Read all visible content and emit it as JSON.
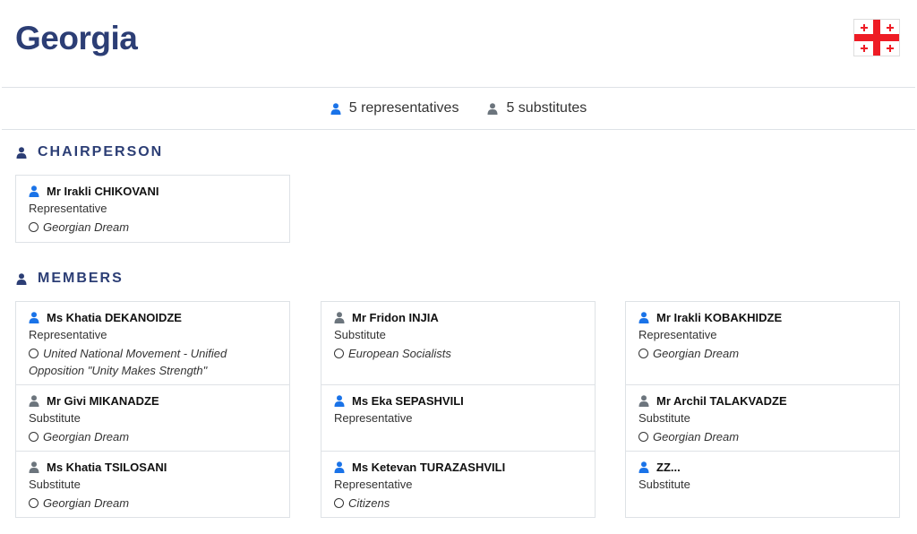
{
  "header": {
    "title": "Georgia",
    "flag_icon": "georgia-flag-icon"
  },
  "summary": {
    "representatives": "5 representatives",
    "substitutes": "5 substitutes"
  },
  "sections": {
    "chairperson_title": "CHAIRPERSON",
    "members_title": "MEMBERS"
  },
  "chairperson": {
    "name": "Mr Irakli CHIKOVANI",
    "role": "Representative",
    "party": "Georgian Dream"
  },
  "members": {
    "col1": [
      {
        "name": "Ms Khatia DEKANOIDZE",
        "role": "Representative",
        "party": "United National Movement - Unified Opposition \"Unity Makes Strength\""
      },
      {
        "name": "Mr Givi MIKANADZE",
        "role": "Substitute",
        "party": "Georgian Dream"
      },
      {
        "name": "Ms Khatia TSILOSANI",
        "role": "Substitute",
        "party": "Georgian Dream"
      }
    ],
    "col2": [
      {
        "name": "Mr Fridon INJIA",
        "role": "Substitute",
        "party": "European Socialists"
      },
      {
        "name": "Ms Eka SEPASHVILI",
        "role": "Representative",
        "party": ""
      },
      {
        "name": "Ms Ketevan TURAZASHVILI",
        "role": "Representative",
        "party": "Citizens"
      }
    ],
    "col3": [
      {
        "name": "Mr Irakli KOBAKHIDZE",
        "role": "Representative",
        "party": "Georgian Dream"
      },
      {
        "name": "Mr Archil TALAKVADZE",
        "role": "Substitute",
        "party": "Georgian Dream"
      },
      {
        "name": "ZZ...",
        "role": "Substitute",
        "party": ""
      }
    ]
  },
  "colors": {
    "title": "#2c3e75",
    "representative_icon": "#1a73e8",
    "substitute_icon": "#6c757d",
    "flag_red": "#ee1c25"
  }
}
